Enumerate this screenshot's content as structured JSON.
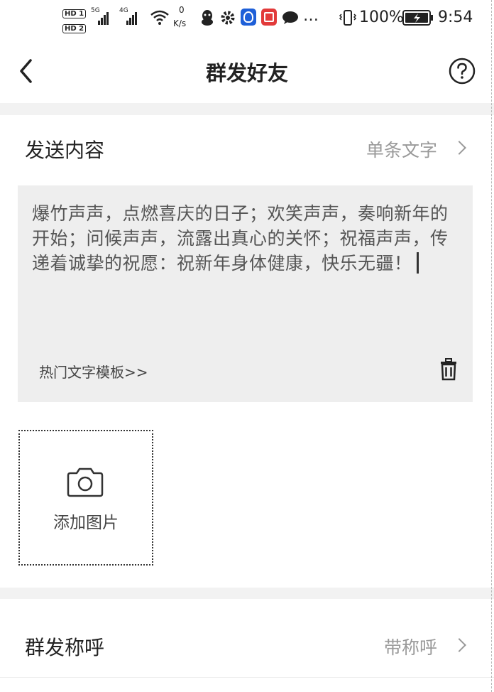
{
  "status_bar": {
    "hd1": "HD 1",
    "hd2": "HD 2",
    "net5g": "5G",
    "net4g": "4G",
    "speed_value": "0",
    "speed_unit": "K/s",
    "battery": "100%",
    "time": "9:54"
  },
  "nav": {
    "title": "群发好友",
    "back_icon": "chevron-left-icon",
    "help_icon": "question-circle-icon"
  },
  "send_content": {
    "label": "发送内容",
    "value": "单条文字"
  },
  "message": {
    "text": "爆竹声声，点燃喜庆的日子；欢笑声声，奏响新年的开始；问候声声，流露出真心的关怀；祝福声声，传递着诚挚的祝愿：祝新年身体健康，快乐无疆！",
    "template_link": "热门文字模板>>"
  },
  "add_image": {
    "label": "添加图片"
  },
  "salutation": {
    "label": "群发称呼",
    "value": "带称呼"
  }
}
